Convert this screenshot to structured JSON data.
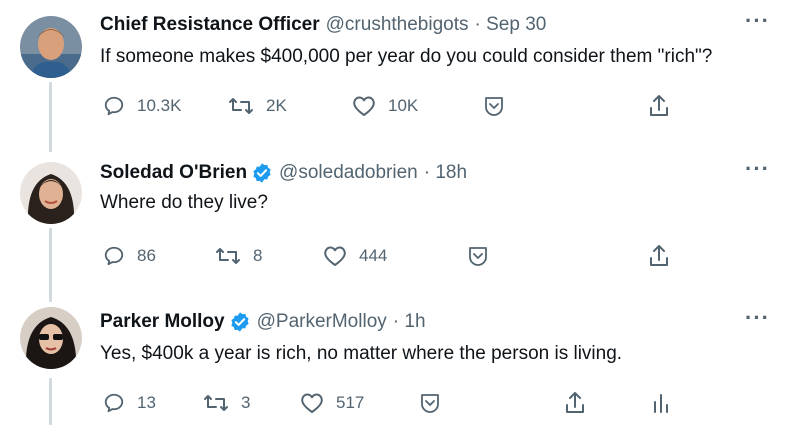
{
  "tweets": [
    {
      "name": "Chief Resistance Officer",
      "handle": "@crushthebigots",
      "time": "· Sep 30",
      "verified": false,
      "text": "If someone makes $400,000 per year do you could consider them \"rich\"?",
      "replies": "10.3K",
      "retweets": "2K",
      "likes": "10K",
      "more": "···"
    },
    {
      "name": "Soledad O'Brien",
      "handle": "@soledadobrien",
      "time": "· 18h",
      "verified": true,
      "text": "Where do they live?",
      "replies": "86",
      "retweets": "8",
      "likes": "444",
      "more": "···"
    },
    {
      "name": "Parker Molloy",
      "handle": "@ParkerMolloy",
      "time": "· 1h",
      "verified": true,
      "text": "Yes, $400k a year is rich, no matter where the person is living.",
      "replies": "13",
      "retweets": "3",
      "likes": "517",
      "more": "···"
    }
  ],
  "colors": {
    "verified": "#1d9bf0",
    "muted": "#536471",
    "thread_line": "#cfd9de"
  },
  "icons": [
    "reply-icon",
    "retweet-icon",
    "like-icon",
    "save-icon",
    "share-icon",
    "analytics-icon",
    "verified-icon"
  ]
}
